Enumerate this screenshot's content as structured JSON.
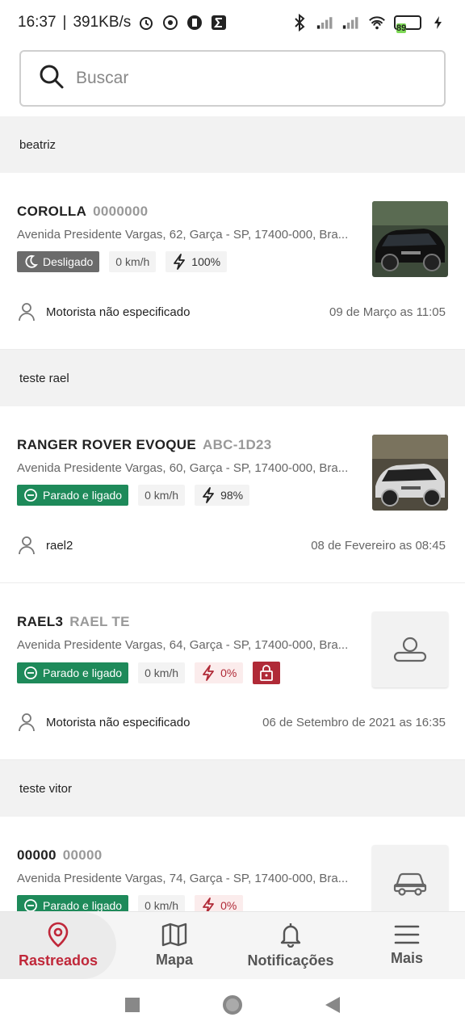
{
  "status_bar": {
    "time": "16:37",
    "speed": "391KB/s",
    "battery": "89"
  },
  "search": {
    "placeholder": "Buscar"
  },
  "groups": [
    {
      "name": "beatriz"
    },
    {
      "name": "teste rael"
    },
    {
      "name": "teste vitor"
    }
  ],
  "vehicles": [
    {
      "name": "COROLLA",
      "plate": "0000000",
      "address": "Avenida Presidente Vargas, 62, Garça - SP, 17400-000, Bra...",
      "status": "Desligado",
      "speed": "0 km/h",
      "battery": "100%",
      "driver": "Motorista não especificado",
      "date": "09 de Março as 11:05"
    },
    {
      "name": "RANGER ROVER EVOQUE",
      "plate": "ABC-1D23",
      "address": "Avenida Presidente Vargas, 60, Garça - SP, 17400-000, Bra...",
      "status": "Parado e ligado",
      "speed": "0 km/h",
      "battery": "98%",
      "driver": "rael2",
      "date": "08 de Fevereiro as 08:45"
    },
    {
      "name": "RAEL3",
      "plate": "RAEL TE",
      "address": "Avenida Presidente Vargas, 64, Garça - SP, 17400-000, Bra...",
      "status": "Parado e ligado",
      "speed": "0 km/h",
      "battery": "0%",
      "driver": "Motorista não especificado",
      "date": "06 de Setembro de 2021 as 16:35"
    },
    {
      "name": "00000",
      "plate": "00000",
      "address": "Avenida Presidente Vargas, 74, Garça - SP, 17400-000, Bra...",
      "status": "Parado e ligado",
      "speed": "0 km/h",
      "battery": "0%"
    }
  ],
  "nav": {
    "items": [
      {
        "label": "Rastreados",
        "icon": "map-pin-icon"
      },
      {
        "label": "Mapa",
        "icon": "map-icon"
      },
      {
        "label": "Notificações",
        "icon": "bell-icon"
      },
      {
        "label": "Mais",
        "icon": "menu-icon"
      }
    ]
  },
  "colors": {
    "accent": "#c0283a",
    "on_status": "#1e8a5a",
    "off_status": "#6b6b6b"
  }
}
